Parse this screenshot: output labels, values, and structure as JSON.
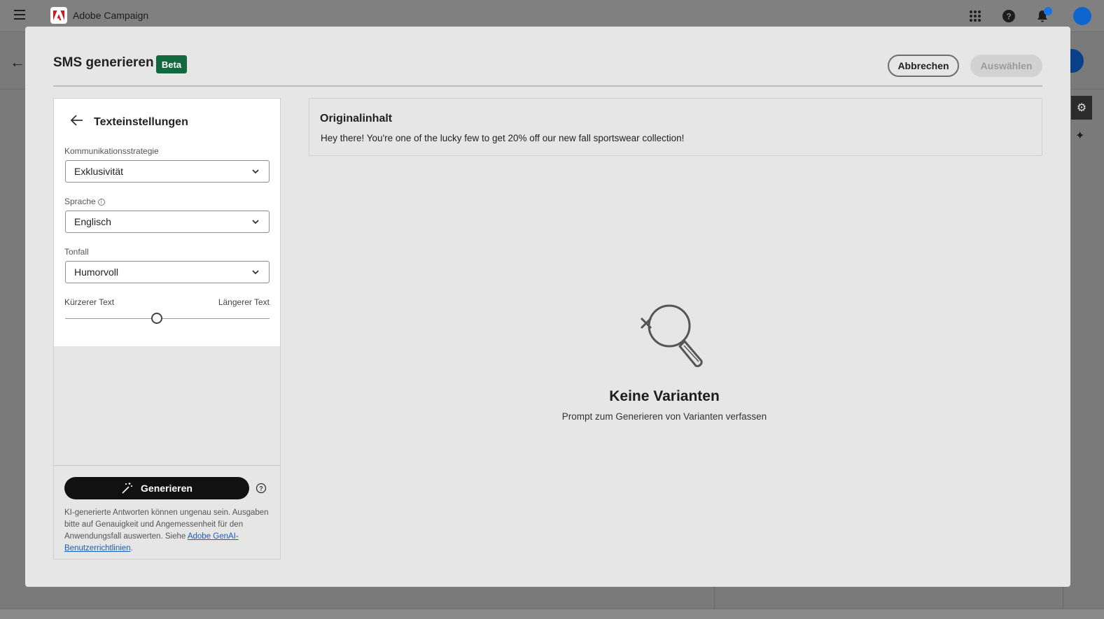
{
  "app": {
    "name": "Adobe Campaign"
  },
  "modal": {
    "title": "SMS generieren",
    "badge": "Beta",
    "cancel_label": "Abbrechen",
    "select_label": "Auswählen"
  },
  "settings": {
    "title": "Texteinstellungen",
    "strategy": {
      "label": "Kommunikationsstrategie",
      "value": "Exklusivität"
    },
    "language": {
      "label": "Sprache",
      "value": "Englisch"
    },
    "tone": {
      "label": "Tonfall",
      "value": "Humorvoll"
    },
    "length": {
      "min_label": "Kürzerer Text",
      "max_label": "Längerer Text",
      "value_fraction": 0.45
    },
    "generate_label": "Generieren",
    "disclaimer": "KI-generierte Antworten können ungenau sein. Ausgaben bitte auf Genauigkeit und Angemessenheit für den Anwendungsfall auswerten. Siehe ",
    "disclaimer_link": "Adobe GenAI-Benutzerrichtlinien",
    "disclaimer_end": "."
  },
  "original": {
    "title": "Originalinhalt",
    "text": "Hey there! You're one of the lucky few to get 20% off our new fall sportswear collection!"
  },
  "empty_state": {
    "title": "Keine Varianten",
    "subtitle": "Prompt zum Generieren von Varianten verfassen"
  },
  "colors": {
    "beta_badge": "#12683f",
    "link": "#1a5cb4",
    "accent_blue": "#1473e6"
  }
}
